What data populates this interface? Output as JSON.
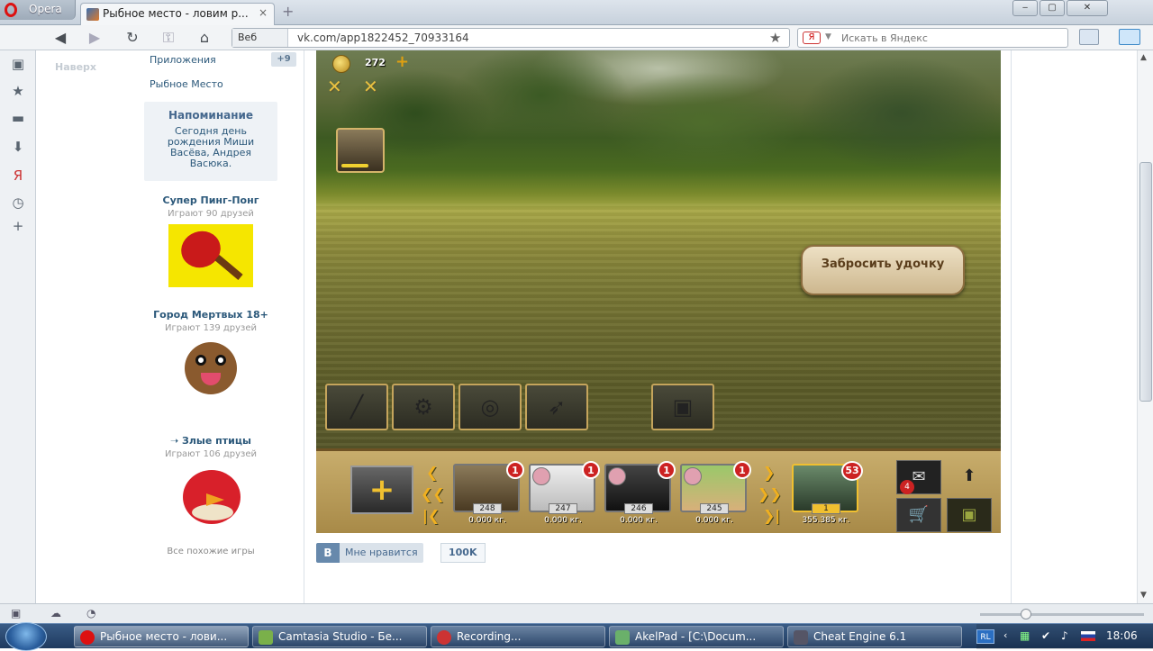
{
  "browser": {
    "app_name": "Opera",
    "tab_title": "Рыбное место - ловим р...",
    "tab_close": "×",
    "new_tab": "+",
    "address_context": "Веб",
    "url": "vk.com/app1822452_70933164",
    "search_engine": "Я",
    "search_placeholder": "Искать в Яндекс",
    "window_controls": [
      "‒",
      "▢",
      "✕"
    ]
  },
  "page": {
    "scroll_top_label": "Наверх",
    "menu": {
      "apps_label": "Приложения",
      "apps_badge": "+9",
      "game_label": "Рыбное Место"
    },
    "reminder": {
      "title": "Напоминание",
      "text": "Сегодня день рождения Миши Васёва, Андрея Васюка."
    },
    "similar_games": [
      {
        "title": "Супер Пинг-Понг",
        "sub": "Играют 90 друзей"
      },
      {
        "title": "Город Мертвых 18+",
        "sub": "Играют 139 друзей"
      },
      {
        "title": "➝ Злые птицы",
        "sub": "Играют 106 друзей"
      }
    ],
    "all_similar": "Все похожие игры",
    "like": {
      "label": "Мне нравится",
      "count": "100K"
    }
  },
  "game": {
    "coins": "272",
    "cast_button": "Забросить удочку",
    "inventory": [
      "fishing-rod-icon",
      "reel-icon",
      "fishing-line-icon",
      "lure-icon",
      "tackle-box-icon"
    ],
    "friends": [
      {
        "level": "248",
        "weight": "0.000 кг.",
        "badge": "1"
      },
      {
        "level": "247",
        "weight": "0.000 кг.",
        "badge": "1"
      },
      {
        "level": "246",
        "weight": "0.000 кг.",
        "badge": "1"
      },
      {
        "level": "245",
        "weight": "0.000 кг.",
        "badge": "1"
      }
    ],
    "me": {
      "level": "1",
      "weight": "355.385 кг.",
      "badge": "53"
    },
    "mail_badge": "4"
  },
  "taskbar": {
    "tasks": [
      "Рыбное место - лови...",
      "Camtasia Studio - Бе...",
      "Recording...",
      "AkelPad - [C:\\Docum...",
      "Cheat Engine 6.1"
    ],
    "lang": "RL",
    "clock": "18:06"
  },
  "colors": {
    "vk_link": "#2b587a",
    "vk_header": "#45688e",
    "accent_red": "#cc2222"
  }
}
